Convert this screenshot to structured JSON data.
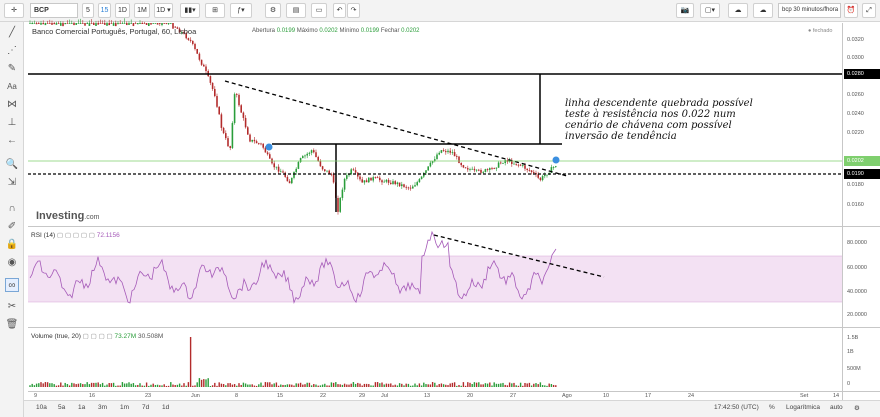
{
  "toolbar": {
    "symbol": "BCP",
    "intervals": [
      {
        "label": "5",
        "active": false
      },
      {
        "label": "15",
        "active": true
      },
      {
        "label": "1D",
        "active": false
      },
      {
        "label": "1M",
        "active": false
      },
      {
        "label": "1D",
        "active": false
      }
    ],
    "ticker": "bcp 30 minutos/fhora"
  },
  "legend": {
    "title": "Banco Comercial Português, Portugal, 60, Lisboa",
    "open_label": "Abertura",
    "open_value": "0.0199",
    "high_label": "Máximo",
    "high_value": "0.0202",
    "low_label": "Mínimo",
    "low_value": "0.0199",
    "close_label": "Fechar",
    "close_value": "0.0202",
    "status": "fechado"
  },
  "price_axis": [
    "0.0320",
    "0.0300",
    "0.0260",
    "0.0240",
    "0.0220",
    "0.0180",
    "0.0160"
  ],
  "price_labels": {
    "resistance": "0.0280",
    "current": "0.0202",
    "support": "0.0190"
  },
  "watermark": "Investing",
  "watermark_suffix": ".com",
  "annotation": [
    "linha descendente quebrada possível",
    "teste à resistência nos 0.022 num",
    "cenário de chávena com possível",
    "inversão de tendência"
  ],
  "rsi": {
    "label": "RSI (14)",
    "value": "72.1156",
    "axis": [
      "80.0000",
      "60.0000",
      "40.0000",
      "20.0000"
    ]
  },
  "volume": {
    "label": "Volume (true, 20)",
    "value1": "73.27M",
    "value2": "30.508M",
    "axis": [
      "1.5B",
      "1B",
      "500M",
      "0"
    ]
  },
  "date_axis": [
    "9",
    "16",
    "23",
    "Jun",
    "8",
    "15",
    "22",
    "29",
    "Jul",
    "13",
    "20",
    "27",
    "Ago",
    "10",
    "17",
    "24",
    "Set",
    "14"
  ],
  "timeframes": [
    "10a",
    "5a",
    "1a",
    "3m",
    "1m",
    "7d",
    "1d"
  ],
  "status_bar": {
    "time": "17:42:50 (UTC)",
    "percent": "%",
    "log": "Logarítmica",
    "auto": "auto"
  },
  "colors": {
    "up": "#2a9d3a",
    "down": "#b32b2b",
    "rsi_band": "#f3e1f3",
    "rsi_line": "#a55ab8",
    "current_price": "#7fcf6e"
  }
}
